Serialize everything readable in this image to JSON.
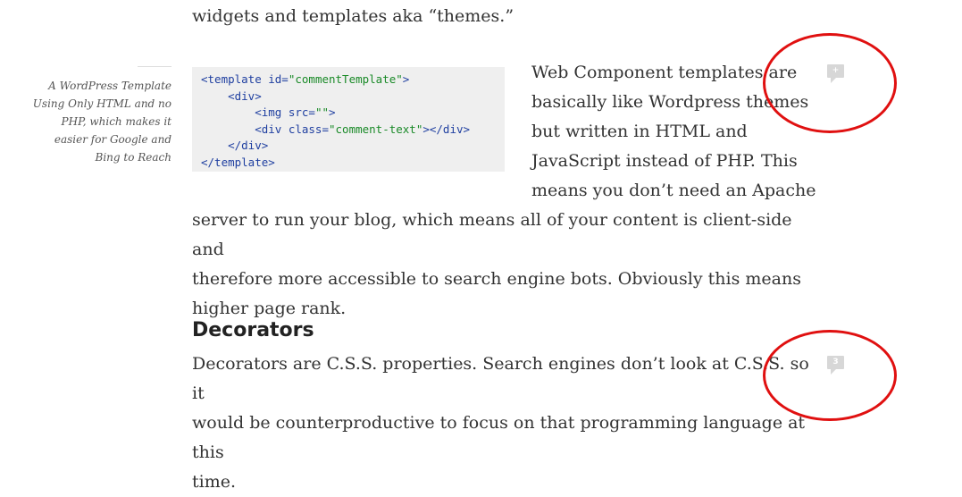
{
  "article": {
    "top_line": "widgets and templates aka “themes.”",
    "caption": "A WordPress Template Using Only HTML and no PHP, which makes it easier for Google and Bing to Reach",
    "code_lines": [
      [
        {
          "t": "tag",
          "v": "<template id="
        },
        {
          "t": "val",
          "v": "\"commentTemplate\""
        },
        {
          "t": "tag",
          "v": ">"
        }
      ],
      [
        {
          "t": "tag",
          "v": "    <div>"
        }
      ],
      [
        {
          "t": "tag",
          "v": "        <img src="
        },
        {
          "t": "val",
          "v": "\"\""
        },
        {
          "t": "tag",
          "v": ">"
        }
      ],
      [
        {
          "t": "tag",
          "v": "        <div class="
        },
        {
          "t": "val",
          "v": "\"comment-text\""
        },
        {
          "t": "tag",
          "v": "></div>"
        }
      ],
      [
        {
          "t": "tag",
          "v": "    </div>"
        }
      ],
      [
        {
          "t": "tag",
          "v": "</template>"
        }
      ]
    ],
    "para1_right_lines": [
      "Web Component templates are",
      "basically like Wordpress themes",
      "but written in HTML and",
      "JavaScript instead of PHP. This",
      "means you don’t need an Apache"
    ],
    "para1_full_lines": [
      "server to run your blog, which means all of your content is client-side and",
      "therefore more accessible to search engine bots. Obviously this means",
      "higher page rank."
    ],
    "heading": "Decorators",
    "para2_lines": [
      "Decorators are C.S.S. properties. Search engines don’t look at C.S.S. so it",
      "would be counterproductive to focus on that programming language at this",
      "time."
    ]
  },
  "comments": {
    "paragraph1_count": "+",
    "paragraph2_count": "3"
  },
  "colors": {
    "annotation_ring": "#e01010",
    "comment_bubble": "#d7d7d7",
    "code_background": "#efefef",
    "code_tag": "#1f3fa0",
    "code_value": "#1a8a28"
  }
}
